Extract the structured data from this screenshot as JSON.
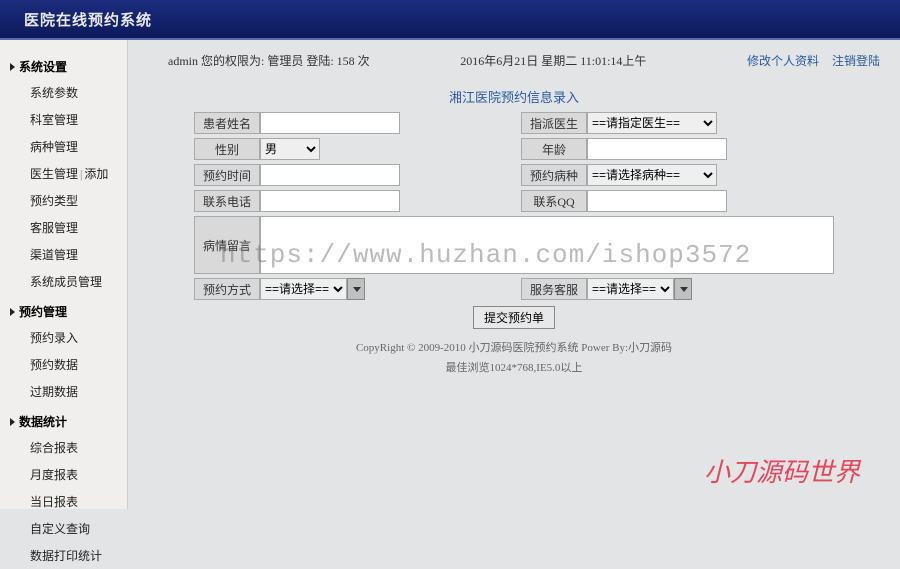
{
  "header": {
    "title": "医院在线预约系统"
  },
  "sidebar": {
    "g1": {
      "head": "系统设置",
      "i0": "系统参数",
      "i1": "科室管理",
      "i2": "病种管理",
      "i3a": "医生管理",
      "i3sep": "|",
      "i3b": "添加",
      "i4": "预约类型",
      "i5": "客服管理",
      "i6": "渠道管理",
      "i7": "系统成员管理"
    },
    "g2": {
      "head": "预约管理",
      "i0": "预约录入",
      "i1": "预约数据",
      "i2": "过期数据"
    },
    "g3": {
      "head": "数据统计",
      "i0": "综合报表",
      "i1": "月度报表",
      "i2": "当日报表",
      "i3": "自定义查询",
      "i4": "数据打印统计"
    }
  },
  "topbar": {
    "left": "admin 您的权限为: 管理员 登陆: 158 次",
    "center": "2016年6月21日 星期二 11:01:14上午",
    "link1": "修改个人资料",
    "link2": "注销登陆"
  },
  "form": {
    "title": "湘江医院预约信息录入",
    "patient_name": "患者姓名",
    "gender": "性别",
    "gender_opt": "男",
    "doctor": "指派医生",
    "doctor_opt": "==请指定医生==",
    "age": "年龄",
    "book_time": "预约时间",
    "disease": "预约病种",
    "disease_opt": "==请选择病种==",
    "phone": "联系电话",
    "qq": "联系QQ",
    "remark": "病情留言",
    "method": "预约方式",
    "method_opt": "==请选择==",
    "service": "服务客服",
    "service_opt": "==请选择==",
    "submit": "提交预约单"
  },
  "footer": {
    "l1": "CopyRight © 2009-2010 小刀源码医院预约系统 Power By:小刀源码",
    "l2": "最佳浏览1024*768,IE5.0以上"
  },
  "watermark": "https://www.huzhan.com/ishop3572",
  "watermark2": "小刀源码世界"
}
